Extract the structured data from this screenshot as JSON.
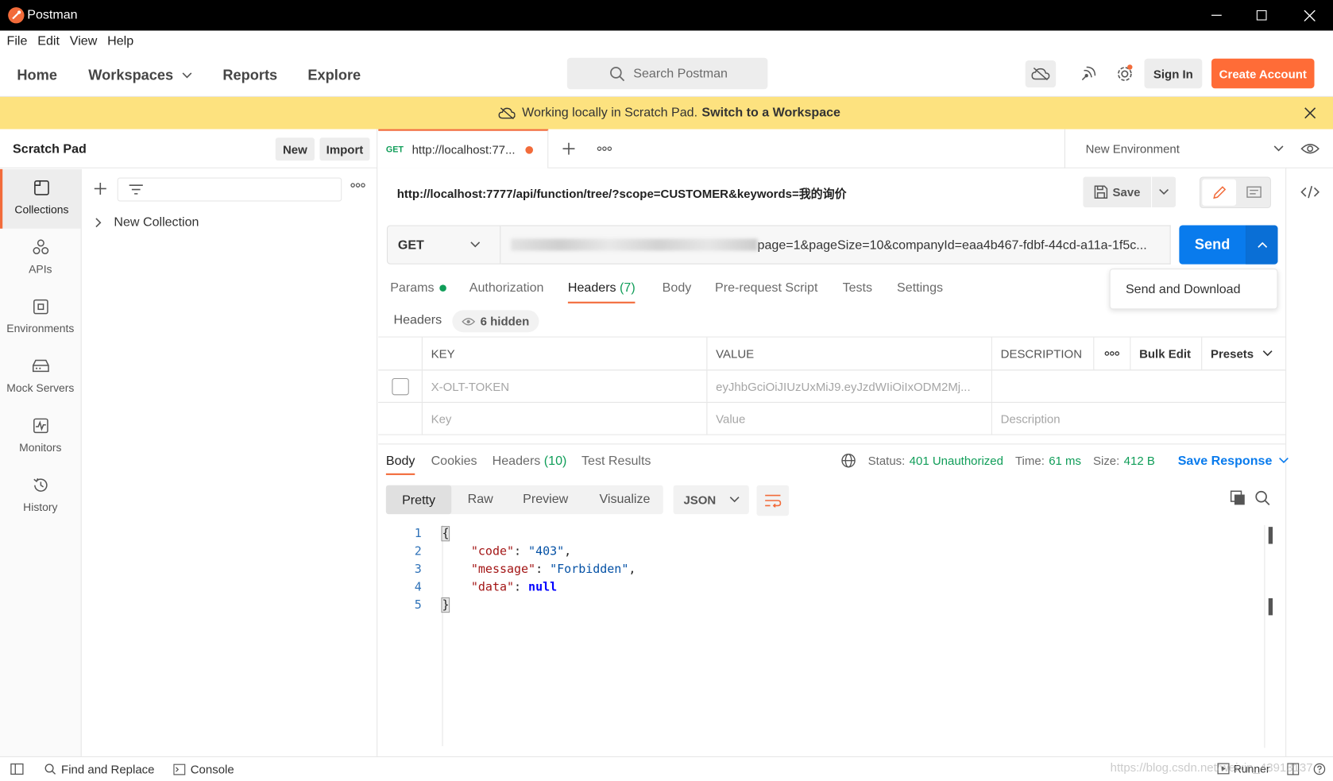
{
  "window": {
    "title": "Postman"
  },
  "menu": [
    "File",
    "Edit",
    "View",
    "Help"
  ],
  "header": {
    "nav": [
      "Home",
      "Workspaces",
      "Reports",
      "Explore"
    ],
    "search_placeholder": "Search Postman",
    "sign_in": "Sign In",
    "create_account": "Create Account"
  },
  "banner": {
    "text": "Working locally in Scratch Pad.",
    "link": "Switch to a Workspace"
  },
  "sidebar": {
    "title": "Scratch Pad",
    "new_label": "New",
    "import_label": "Import",
    "rail": [
      {
        "label": "Collections",
        "icon": "collections-icon"
      },
      {
        "label": "APIs",
        "icon": "apis-icon"
      },
      {
        "label": "Environments",
        "icon": "environments-icon"
      },
      {
        "label": "Mock Servers",
        "icon": "mock-servers-icon"
      },
      {
        "label": "Monitors",
        "icon": "monitors-icon"
      },
      {
        "label": "History",
        "icon": "history-icon"
      }
    ],
    "collection": "New Collection"
  },
  "tab": {
    "method": "GET",
    "title": "http://localhost:77..."
  },
  "environment": "New Environment",
  "request": {
    "url_title": "http://localhost:7777/api/function/tree/?scope=CUSTOMER&keywords=我的询价",
    "save_label": "Save",
    "method": "GET",
    "url_value": "page=1&pageSize=10&companyId=eaa4b467-fdbf-44cd-a11a-1f5c...",
    "send_label": "Send",
    "send_dropdown": "Send and Download"
  },
  "req_tabs": {
    "params": "Params",
    "authorization": "Authorization",
    "headers": "Headers",
    "headers_count": "(7)",
    "body": "Body",
    "prerequest": "Pre-request Script",
    "tests": "Tests",
    "settings": "Settings"
  },
  "headers_section": {
    "label": "Headers",
    "hidden": "6 hidden"
  },
  "headers_table": {
    "columns": {
      "key": "KEY",
      "value": "VALUE",
      "description": "DESCRIPTION",
      "bulk_edit": "Bulk Edit",
      "presets": "Presets"
    },
    "rows": [
      {
        "key": "X-OLT-TOKEN",
        "value": "eyJhbGciOiJIUzUxMiJ9.eyJzdWIiOiIxODM2Mj...",
        "description": ""
      }
    ],
    "placeholder": {
      "key": "Key",
      "value": "Value",
      "description": "Description"
    }
  },
  "response": {
    "tabs": {
      "body": "Body",
      "cookies": "Cookies",
      "headers": "Headers",
      "headers_count": "(10)",
      "test_results": "Test Results"
    },
    "status_label": "Status:",
    "status_value": "401 Unauthorized",
    "time_label": "Time:",
    "time_value": "61 ms",
    "size_label": "Size:",
    "size_value": "412 B",
    "save_response": "Save Response",
    "view_modes": [
      "Pretty",
      "Raw",
      "Preview",
      "Visualize"
    ],
    "format": "JSON",
    "lines": [
      {
        "n": "1",
        "text": "{"
      },
      {
        "n": "2",
        "key": "\"code\"",
        "value": "\"403\"",
        "sep": ","
      },
      {
        "n": "3",
        "key": "\"message\"",
        "value": "\"Forbidden\"",
        "sep": ","
      },
      {
        "n": "4",
        "key": "\"data\"",
        "value": "null",
        "sep": ""
      },
      {
        "n": "5",
        "text": "}"
      }
    ]
  },
  "statusbar": {
    "find_replace": "Find and Replace",
    "console": "Console",
    "runner": "Runner",
    "watermark": "https://blog.csdn.net/weixin_43913137"
  },
  "colors": {
    "accent": "#f26b3a",
    "send": "#097bed",
    "success": "#0f9d58",
    "banner": "#fde27f"
  }
}
